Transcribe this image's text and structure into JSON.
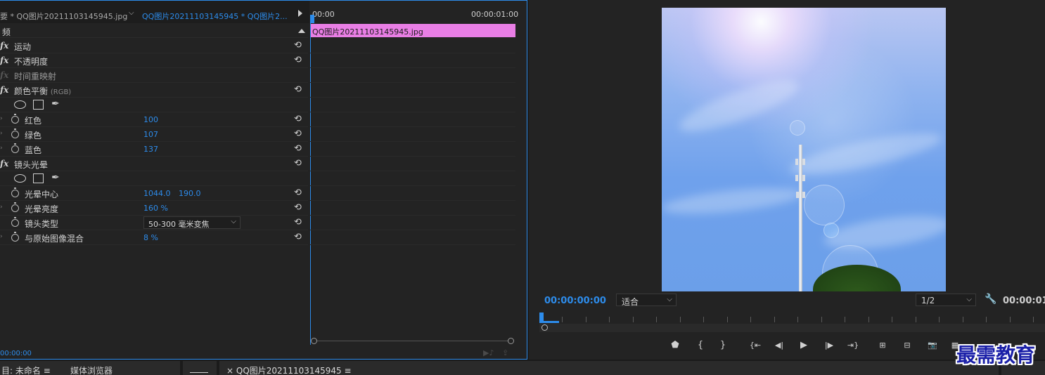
{
  "effect_controls": {
    "header": {
      "master_tab": "要 * QQ图片20211103145945.jpg",
      "clip_tab": "QQ图片20211103145945 * QQ图片2..."
    },
    "section_title": "频",
    "effects": {
      "motion": "运动",
      "opacity": "不透明度",
      "time_remap": "时间重映射",
      "color_balance": "颜色平衡",
      "color_balance_suffix": "(RGB)",
      "lens_flare": "镜头光晕"
    },
    "fx_label": "fx",
    "params": {
      "red": {
        "label": "红色",
        "value": "100"
      },
      "green": {
        "label": "绿色",
        "value": "107"
      },
      "blue": {
        "label": "蓝色",
        "value": "137"
      },
      "flare_center": {
        "label": "光晕中心",
        "x": "1044.0",
        "y": "190.0"
      },
      "flare_brightness": {
        "label": "光晕亮度",
        "value": "160 %"
      },
      "lens_type": {
        "label": "镜头类型",
        "value": "50-300 毫米变焦"
      },
      "blend_original": {
        "label": "与原始图像混合",
        "value": "8 %"
      }
    },
    "timecode": "00:00:00",
    "timeline": {
      "start": "00:00",
      "end": "00:00:01:00",
      "clip_name": "QQ图片20211103145945.jpg"
    }
  },
  "program_monitor": {
    "timecode": "00:00:00:00",
    "fit_option": "适合",
    "resolution": "1/2",
    "duration": "00:00:01:"
  },
  "bottom_tabs": {
    "project": "目: 未命名",
    "media_browser": "媒体浏览器",
    "sequence_close": "×",
    "sequence": "QQ图片20211103145945",
    "menu_glyph": "≡"
  },
  "watermark": "最需教育",
  "colors": {
    "accent": "#2d8ceb",
    "clip": "#e97ee5",
    "panel": "#232323"
  }
}
